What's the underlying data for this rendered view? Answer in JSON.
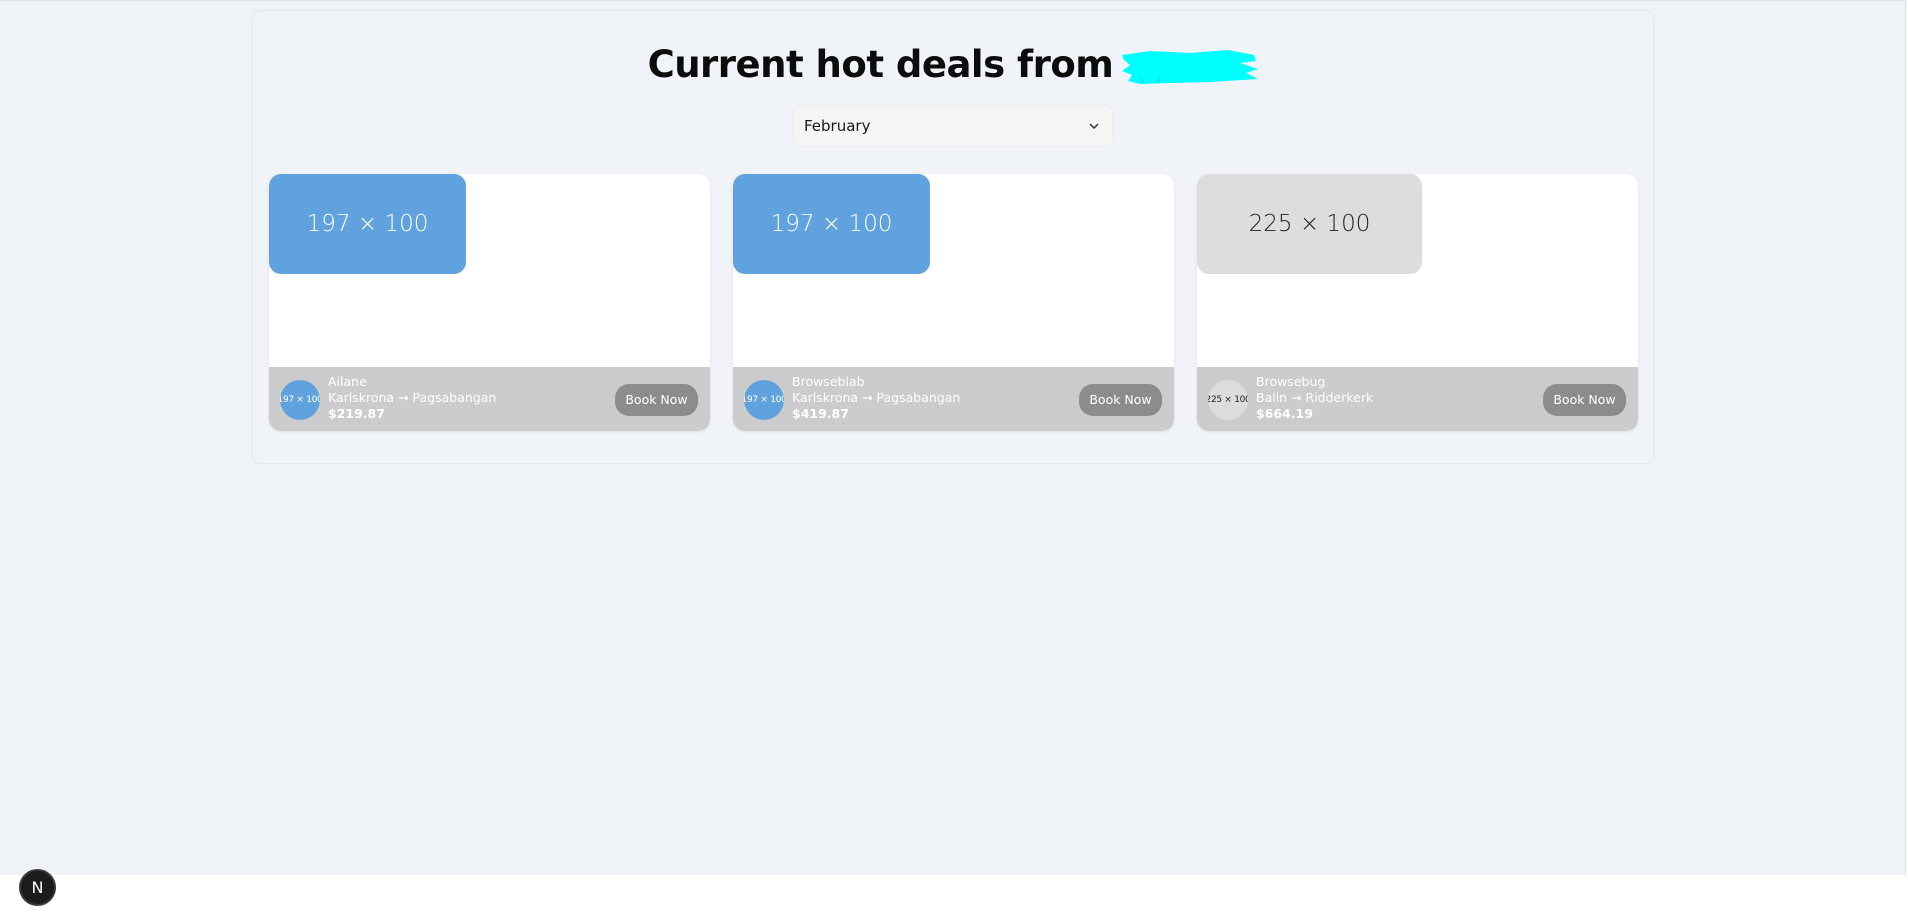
{
  "header": {
    "title": "Current hot deals from",
    "redacted_color": "#00ffff"
  },
  "filter": {
    "selected_month": "February"
  },
  "deals": [
    {
      "image_placeholder": "197 × 100",
      "image_color": "#60a2dd",
      "image_text_color": "#ffffff",
      "logo_placeholder": "197 × 100",
      "airline": "Ailane",
      "route": "Karlskrona → Pagsabangan",
      "price": "$219.87",
      "book_label": "Book Now"
    },
    {
      "image_placeholder": "197 × 100",
      "image_color": "#60a2dd",
      "image_text_color": "#ffffff",
      "logo_placeholder": "197 × 100",
      "airline": "Browseblab",
      "route": "Karlskrona → Pagsabangan",
      "price": "$419.87",
      "book_label": "Book Now"
    },
    {
      "image_placeholder": "225 × 100",
      "image_color": "#dddddd",
      "image_text_color": "#222222",
      "logo_placeholder": "225 × 100",
      "airline": "Browsebug",
      "route": "Balin → Ridderkerk",
      "price": "$664.19",
      "book_label": "Book Now"
    }
  ],
  "dev_badge": {
    "label": "N"
  }
}
